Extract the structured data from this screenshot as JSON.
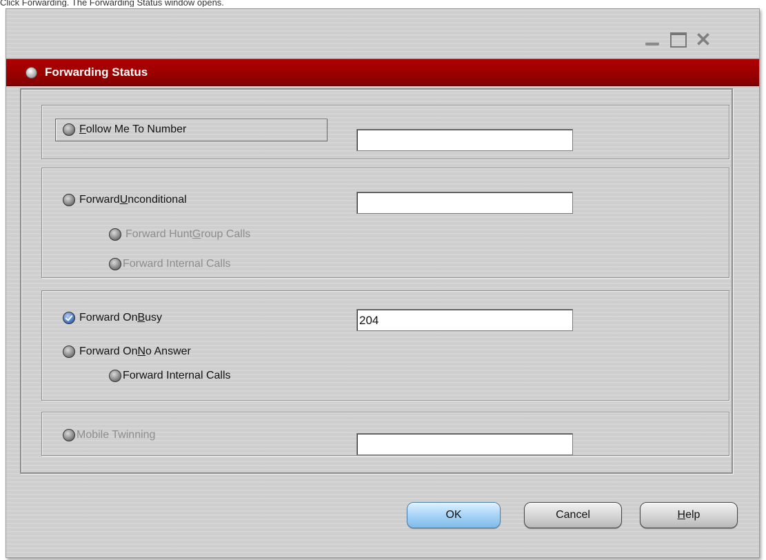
{
  "caption": "Click Forwarding. The Forwarding Status window opens.",
  "window": {
    "title": "Forwarding Status",
    "controls": {
      "minimize": "minimize-icon",
      "maximize": "maximize-icon",
      "close": "close-icon"
    }
  },
  "groups": {
    "follow_me": {
      "label": "Follow Me To Number",
      "accel": "F",
      "rest": "ollow Me To Number",
      "selected": false,
      "value": ""
    },
    "unconditional": {
      "label_pre": "Forward ",
      "accel": "U",
      "label_post": "nconditional",
      "selected": false,
      "value": "",
      "hunt_pre": "Forward Hunt ",
      "hunt_accel": "G",
      "hunt_post": "roup Calls",
      "internal": "Forward Internal Calls"
    },
    "busy_noanswer": {
      "busy_pre": "Forward On ",
      "busy_accel": "B",
      "busy_post": "usy",
      "busy_selected": true,
      "busy_value": "204",
      "noans_pre": "Forward On ",
      "noans_accel": "N",
      "noans_post": "o Answer",
      "noans_selected": false,
      "internal": "Forward Internal Calls"
    },
    "mobile": {
      "label": "Mobile Twinning",
      "value": ""
    }
  },
  "buttons": {
    "ok": "OK",
    "cancel": "Cancel",
    "help_accel": "H",
    "help_rest": "elp"
  },
  "colors": {
    "titlebar": "#9a0000",
    "ok_button": "#a8d4f7",
    "checked_radio": "#5a86d0"
  }
}
